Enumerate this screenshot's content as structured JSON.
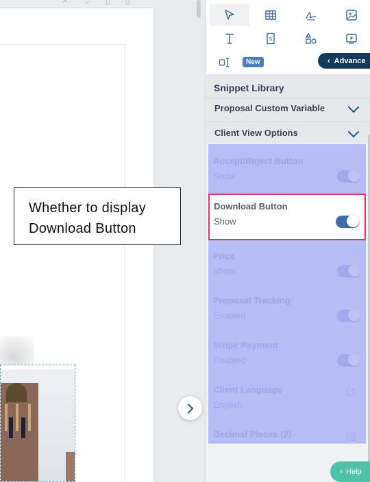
{
  "tooltip": {
    "line1": "Whether to display",
    "line2": "Download Button"
  },
  "tools": {
    "new_badge": "New",
    "advance_label": "Advance"
  },
  "sidebar": {
    "library_title": "Snippet Library",
    "sections": [
      {
        "label": "Proposal Custom Variable"
      },
      {
        "label": "Client View Options"
      }
    ],
    "options": [
      {
        "title": "Accept/Reject Button",
        "value": "Show",
        "control": "toggle",
        "on": true
      },
      {
        "title": "Download Button",
        "value": "Show",
        "control": "toggle",
        "on": true,
        "highlighted": true
      },
      {
        "title": "Price",
        "value": "Show",
        "control": "toggle",
        "on": true
      },
      {
        "title": "Proposal Tracking",
        "value": "Enabled",
        "control": "toggle",
        "on": true
      },
      {
        "title": "Stripe Payment",
        "value": "Enabled",
        "control": "toggle",
        "on": true
      },
      {
        "title": "Client Language",
        "value": "English",
        "control": "edit"
      },
      {
        "title": "Decimal Places (2)",
        "value": "",
        "control": "edit"
      }
    ]
  },
  "help": {
    "label": "Help"
  },
  "colors": {
    "accent": "#123a5c",
    "highlight_border": "#e6336a",
    "overlay": "#b6bcf6",
    "help": "#4ec3a9",
    "toggle_on": "#3d6ea5"
  }
}
